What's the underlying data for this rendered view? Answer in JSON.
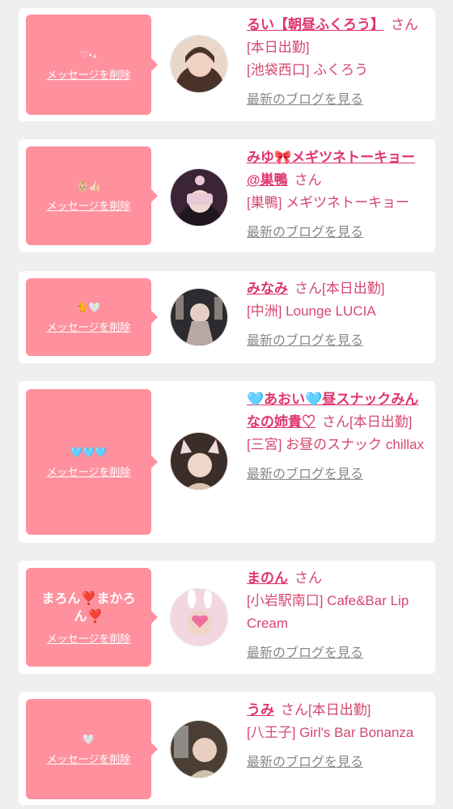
{
  "items": [
    {
      "message": "♡‧₊",
      "delete_label": "メッセージを削除",
      "name": "るい【朝昼ふくろう】",
      "honorific": "さん",
      "status": "[本日出勤]",
      "shop": "[池袋西口] ふくろう",
      "blog_label": "最新のブログを見る",
      "avatar_colors": [
        "#e9d7c9",
        "#4a3228"
      ]
    },
    {
      "message": "👶🏼👍🏻",
      "delete_label": "メッセージを削除",
      "name": "みゆ🎀メギツネトーキョー@巣鴨",
      "honorific": "さん",
      "status": "",
      "shop": "[巣鴨] メギツネトーキョー",
      "blog_label": "最新のブログを見る",
      "avatar_colors": [
        "#3a2436",
        "#e9c8d8"
      ]
    },
    {
      "message": "🐈🤍",
      "delete_label": "メッセージを削除",
      "name": "みなみ",
      "honorific": "さん",
      "status": "[本日出勤]",
      "shop": "[中洲] Lounge LUCIA",
      "blog_label": "最新のブログを見る",
      "avatar_colors": [
        "#2b2b30",
        "#b9a7a2"
      ]
    },
    {
      "message": "🩵🩵🩵",
      "delete_label": "メッセージを削除",
      "name": "🩵あおい🩵昼スナックみんなの姉貴♡",
      "honorific": "さん",
      "status": "[本日出勤]",
      "shop": "[三宮] お昼のスナック chillax",
      "blog_label": "最新のブログを見る",
      "avatar_colors": [
        "#3b2d27",
        "#d8c2b0"
      ]
    },
    {
      "message": "まろん❣️まかろん❣️",
      "delete_label": "メッセージを削除",
      "name": "まのん",
      "honorific": "さん",
      "status": "",
      "shop": "[小岩駅南口] Cafe&Bar Lip Cream",
      "blog_label": "最新のブログを見る",
      "avatar_colors": [
        "#f4d6e2",
        "#ee6f9d"
      ]
    },
    {
      "message": "🤍",
      "delete_label": "メッセージを削除",
      "name": "うみ",
      "honorific": "さん",
      "status": "[本日出勤]",
      "shop": "[八王子] Girl's Bar Bonanza",
      "blog_label": "最新のブログを見る",
      "avatar_colors": [
        "#4b3f35",
        "#cfc0aa"
      ]
    }
  ]
}
